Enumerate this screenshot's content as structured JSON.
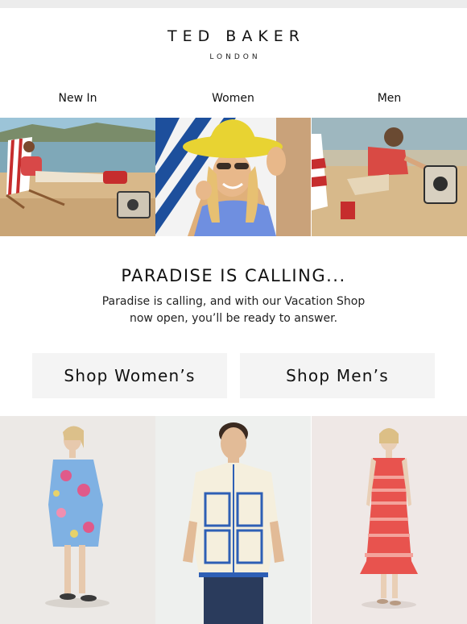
{
  "brand": {
    "name": "TED BAKER",
    "tagline": "LONDON"
  },
  "nav": [
    {
      "label": "New In"
    },
    {
      "label": "Women"
    },
    {
      "label": "Men"
    }
  ],
  "hero": {
    "panels": [
      {
        "name": "man-on-deckchair-beach"
      },
      {
        "name": "woman-in-yellow-sunhat"
      },
      {
        "name": "man-with-radio-on-sand"
      }
    ]
  },
  "headline": "PARADISE IS CALLING...",
  "subcopy": {
    "line1": "Paradise is calling, and with our Vacation Shop",
    "line2": "now open, you’ll be ready to answer."
  },
  "buttons": {
    "women": "Shop Women’s",
    "men": "Shop Men’s"
  },
  "colors": {
    "button_bg": "#f4f4f4",
    "topbar": "#ececec",
    "text": "#111111"
  }
}
